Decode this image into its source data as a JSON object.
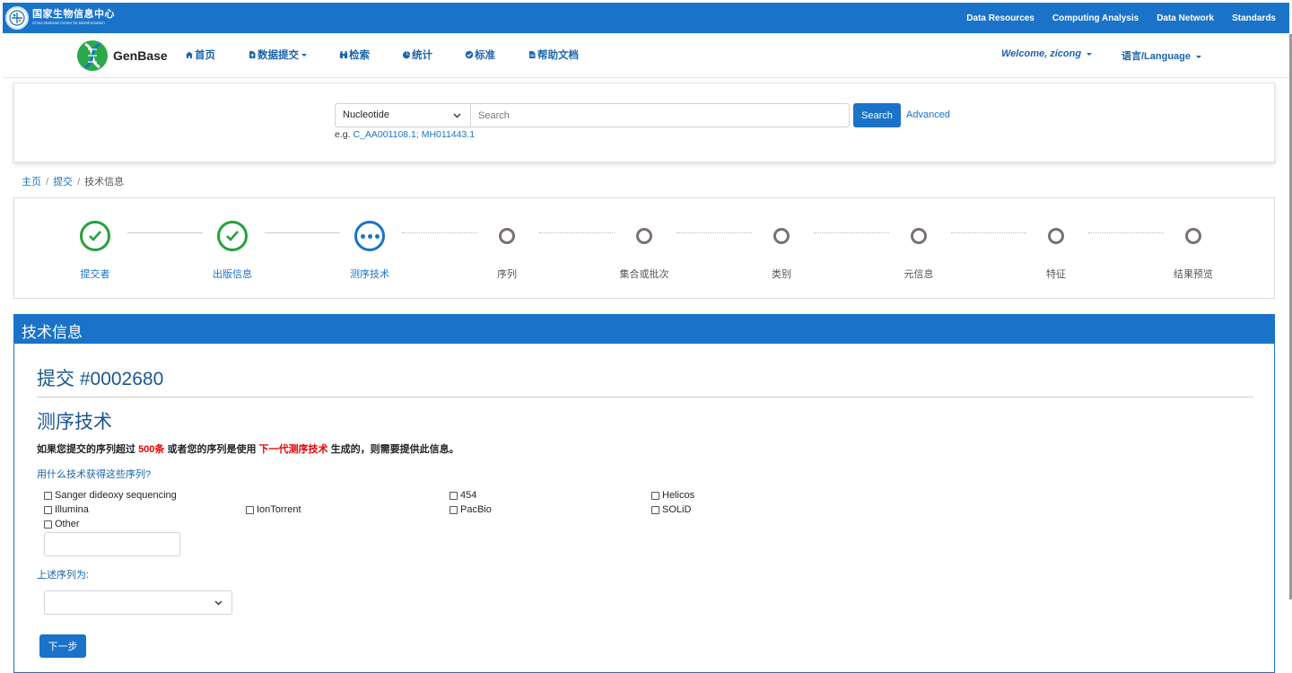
{
  "topbar": {
    "org_cn": "国家生物信息中心",
    "org_en": "China National Center for Bioinformation",
    "links": [
      "Data Resources",
      "Computing Analysis",
      "Data Network",
      "Standards"
    ]
  },
  "nav": {
    "brand": "GenBase",
    "items": [
      {
        "label": "首页",
        "icon": "home-icon"
      },
      {
        "label": "数据提交",
        "icon": "file-upload-icon",
        "dropdown": true
      },
      {
        "label": "检索",
        "icon": "binoculars-icon"
      },
      {
        "label": "统计",
        "icon": "pie-chart-icon"
      },
      {
        "label": "标准",
        "icon": "check-circle-icon"
      },
      {
        "label": "帮助文档",
        "icon": "document-icon"
      }
    ],
    "welcome": "Welcome, zicong",
    "language": "语言/Language"
  },
  "search": {
    "database": "Nucleotide",
    "placeholder": "Search",
    "button": "Search",
    "advanced": "Advanced",
    "example_prefix": "e.g.",
    "example_links": "C_AA001108.1; MH011443.1"
  },
  "breadcrumb": {
    "home": "主页",
    "submit": "提交",
    "current": "技术信息"
  },
  "steps": [
    {
      "label": "提交者",
      "status": "done"
    },
    {
      "label": "出版信息",
      "status": "done"
    },
    {
      "label": "测序技术",
      "status": "active"
    },
    {
      "label": "序列",
      "status": "todo"
    },
    {
      "label": "集合或批次",
      "status": "todo"
    },
    {
      "label": "类别",
      "status": "todo"
    },
    {
      "label": "元信息",
      "status": "todo"
    },
    {
      "label": "特征",
      "status": "todo"
    },
    {
      "label": "结果预览",
      "status": "todo"
    }
  ],
  "panel": {
    "header": "技术信息",
    "submission": "提交 #0002680",
    "section_title": "测序技术",
    "note_a": "如果您提交的序列超过",
    "note_count": "500条",
    "note_b": "或者您的序列是使用",
    "note_tech": "下一代测序技术",
    "note_c": "生成的，则需要提供此信息。",
    "question": "用什么技术获得这些序列?",
    "technologies": [
      "Sanger dideoxy sequencing",
      "454",
      "Helicos",
      "Illumina",
      "IonTorrent",
      "PacBio",
      "SOLiD",
      "Other"
    ],
    "other_value": "",
    "seq_label": "上述序列为:",
    "seq_value": "",
    "next_button": "下一步"
  },
  "colors": {
    "primary": "#1a73c9",
    "done": "#25a13a",
    "todo": "#7a7070",
    "highlight": "#e60000"
  }
}
